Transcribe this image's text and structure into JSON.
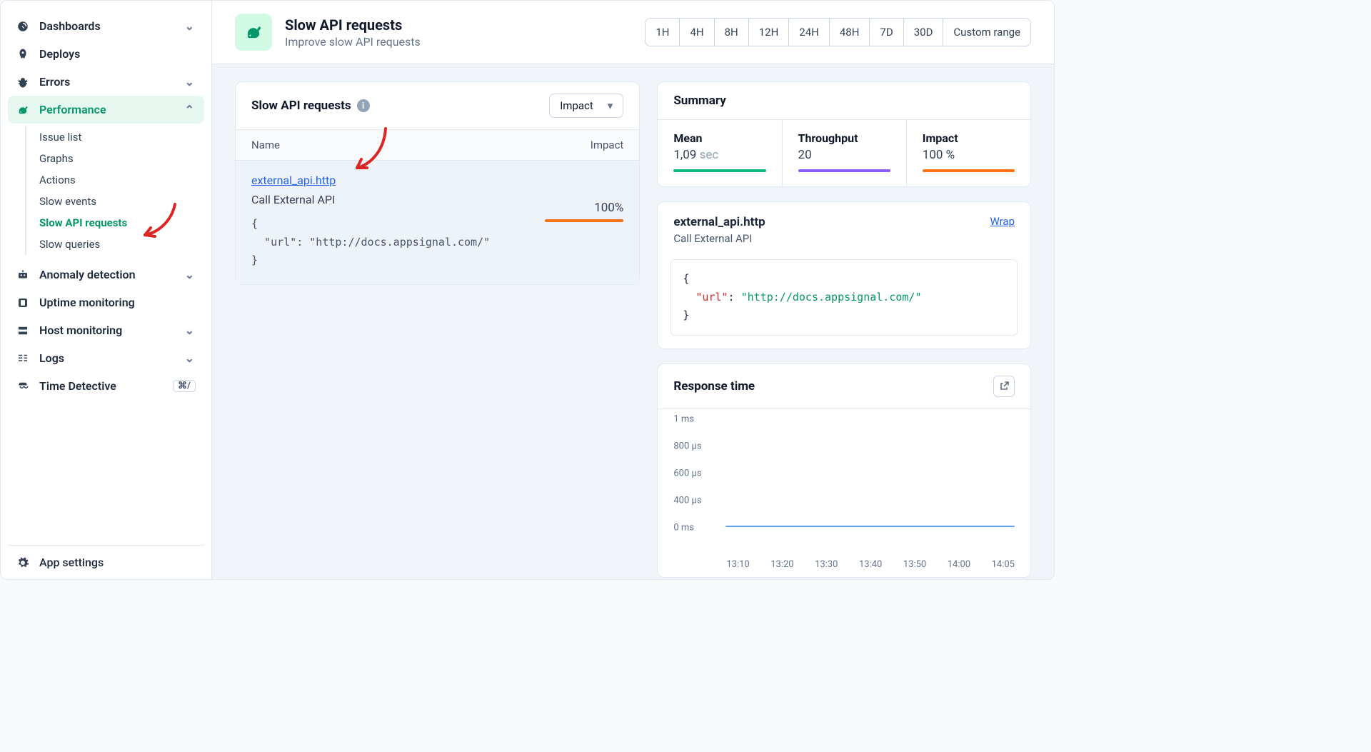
{
  "sidebar": {
    "items": [
      {
        "label": "Dashboards",
        "icon": "gauge",
        "expandable": true
      },
      {
        "label": "Deploys",
        "icon": "rocket"
      },
      {
        "label": "Errors",
        "icon": "bug",
        "expandable": true
      },
      {
        "label": "Performance",
        "icon": "rabbit",
        "expandable": true,
        "active": true
      },
      {
        "label": "Anomaly detection",
        "icon": "robot",
        "expandable": true
      },
      {
        "label": "Uptime monitoring",
        "icon": "monitor"
      },
      {
        "label": "Host monitoring",
        "icon": "server",
        "expandable": true
      },
      {
        "label": "Logs",
        "icon": "logs",
        "expandable": true
      },
      {
        "label": "Time Detective",
        "icon": "detective",
        "badge": "⌘/"
      }
    ],
    "sub_performance": [
      {
        "label": "Issue list"
      },
      {
        "label": "Graphs"
      },
      {
        "label": "Actions"
      },
      {
        "label": "Slow events"
      },
      {
        "label": "Slow API requests",
        "active": true
      },
      {
        "label": "Slow queries"
      }
    ],
    "footer": {
      "label": "App settings",
      "icon": "gear"
    }
  },
  "header": {
    "title": "Slow API requests",
    "subtitle": "Improve slow API requests",
    "timerange": [
      "1H",
      "4H",
      "8H",
      "12H",
      "24H",
      "48H",
      "7D",
      "30D",
      "Custom range"
    ]
  },
  "slow_panel": {
    "title": "Slow API requests",
    "sort_selected": "Impact",
    "columns": {
      "name": "Name",
      "impact": "Impact"
    },
    "row": {
      "name": "external_api.http",
      "desc": "Call External API",
      "json": "{\n  \"url\": \"http://docs.appsignal.com/\"\n}",
      "impact_pct": "100%"
    }
  },
  "summary": {
    "title": "Summary",
    "mean": {
      "label": "Mean",
      "value": "1,09",
      "unit": "sec",
      "color": "#10b981"
    },
    "throughput": {
      "label": "Throughput",
      "value": "20",
      "color": "#8b5cf6"
    },
    "impact": {
      "label": "Impact",
      "value": "100 %",
      "color": "#f97316"
    }
  },
  "detail": {
    "title": "external_api.http",
    "subtitle": "Call External API",
    "wrap_label": "Wrap",
    "json_key": "\"url\"",
    "json_val": "\"http://docs.appsignal.com/\""
  },
  "response_time": {
    "title": "Response time",
    "y_ticks": [
      "1 ms",
      "800 µs",
      "600  µs",
      "400  µs",
      "0 ms"
    ],
    "x_ticks": [
      "13:10",
      "13:20",
      "13:30",
      "13:40",
      "13:50",
      "14:00",
      "14:05"
    ]
  },
  "chart_data": {
    "type": "line",
    "title": "Response time",
    "xlabel": "",
    "ylabel": "",
    "y_ticks_display": [
      "1 ms",
      "800 µs",
      "600 µs",
      "400 µs",
      "0 ms"
    ],
    "x": [
      "13:10",
      "13:20",
      "13:30",
      "13:40",
      "13:50",
      "14:00",
      "14:05"
    ],
    "series": [
      {
        "name": "response_time_us",
        "values": [
          20,
          20,
          20,
          20,
          20,
          20,
          20
        ]
      }
    ],
    "ylim_us": [
      0,
      1000
    ]
  }
}
